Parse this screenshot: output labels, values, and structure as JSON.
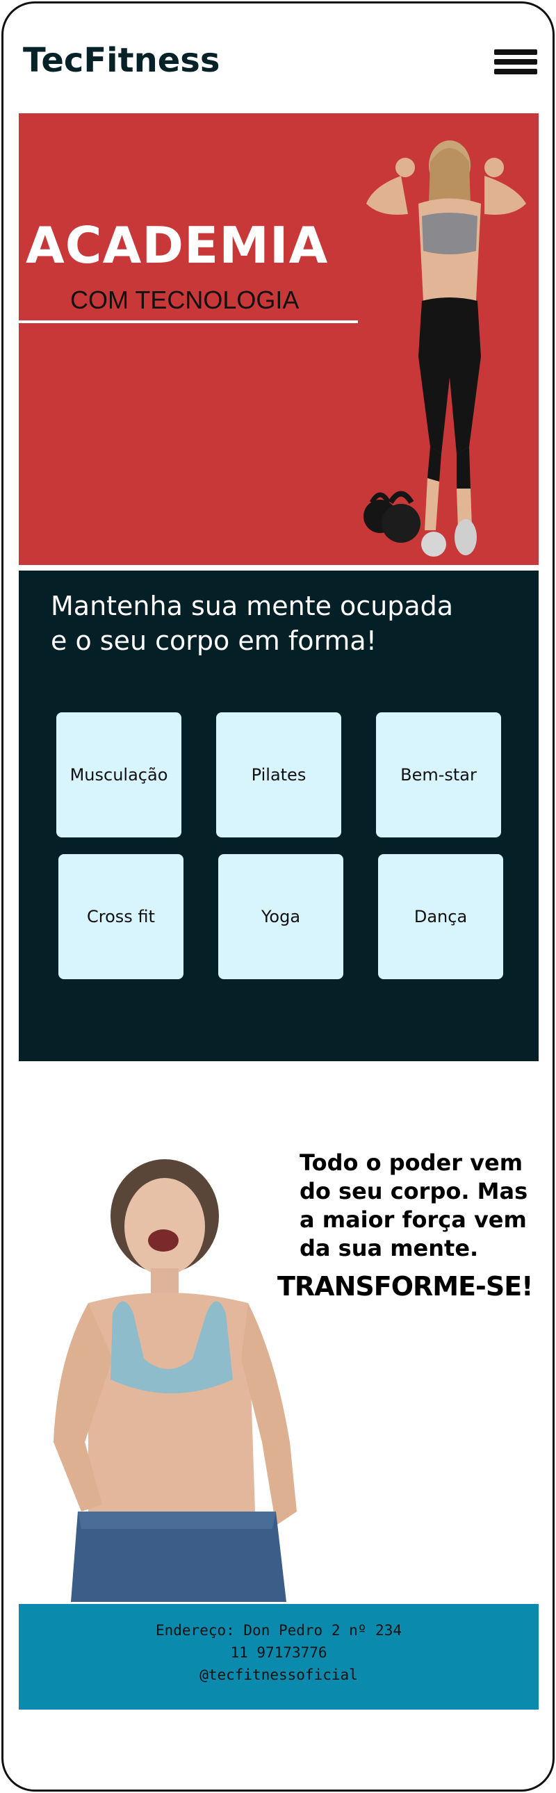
{
  "header": {
    "logo": "TecFitness",
    "menu_icon": "hamburger-menu-icon"
  },
  "hero": {
    "title": "ACADEMIA",
    "subtitle": "COM TECNOLOGIA",
    "background_color": "#c93838"
  },
  "activities": {
    "tagline_line1": "Mantenha sua mente ocupada",
    "tagline_line2": "e o seu corpo em forma!",
    "items": [
      {
        "label": "Musculação"
      },
      {
        "label": "Pilates"
      },
      {
        "label": "Bem-star"
      },
      {
        "label": "Cross fit"
      },
      {
        "label": "Yoga"
      },
      {
        "label": "Dança"
      }
    ],
    "background_color": "#041f26",
    "tile_color": "#d8f4fc"
  },
  "motivation": {
    "quote_lines": [
      "Todo o poder vem",
      "do seu corpo. Mas",
      "a maior força vem",
      "da sua mente."
    ],
    "cta": "TRANSFORME-SE!"
  },
  "footer": {
    "address": "Endereço: Don Pedro 2 nº 234",
    "phone": "11 97173776",
    "social": "@tecfitnessoficial",
    "background_color": "#0a8aad"
  }
}
